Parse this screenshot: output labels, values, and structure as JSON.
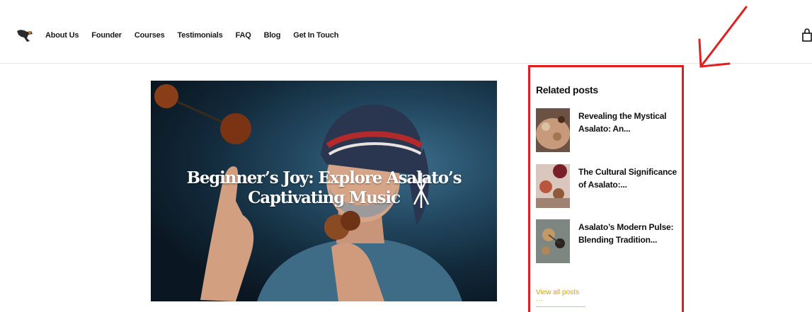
{
  "nav": {
    "items": [
      "About Us",
      "Founder",
      "Courses",
      "Testimonials",
      "FAQ",
      "Blog",
      "Get In Touch"
    ]
  },
  "icons": {
    "logo": "asalato-logo",
    "cart": "bag-icon"
  },
  "hero": {
    "title": "Beginner’s Joy: Explore Asalato’s Captivating Music"
  },
  "sidebar": {
    "heading": "Related posts",
    "posts": [
      {
        "title": "Revealing the Mystical Asalato: An..."
      },
      {
        "title": "The Cultural Significance of Asalato:..."
      },
      {
        "title": "Asalato’s Modern Pulse: Blending Tradition..."
      }
    ],
    "view_all": "View all posts ···"
  },
  "colors": {
    "annotation": "#e02020",
    "link_accent": "#d4a017"
  }
}
